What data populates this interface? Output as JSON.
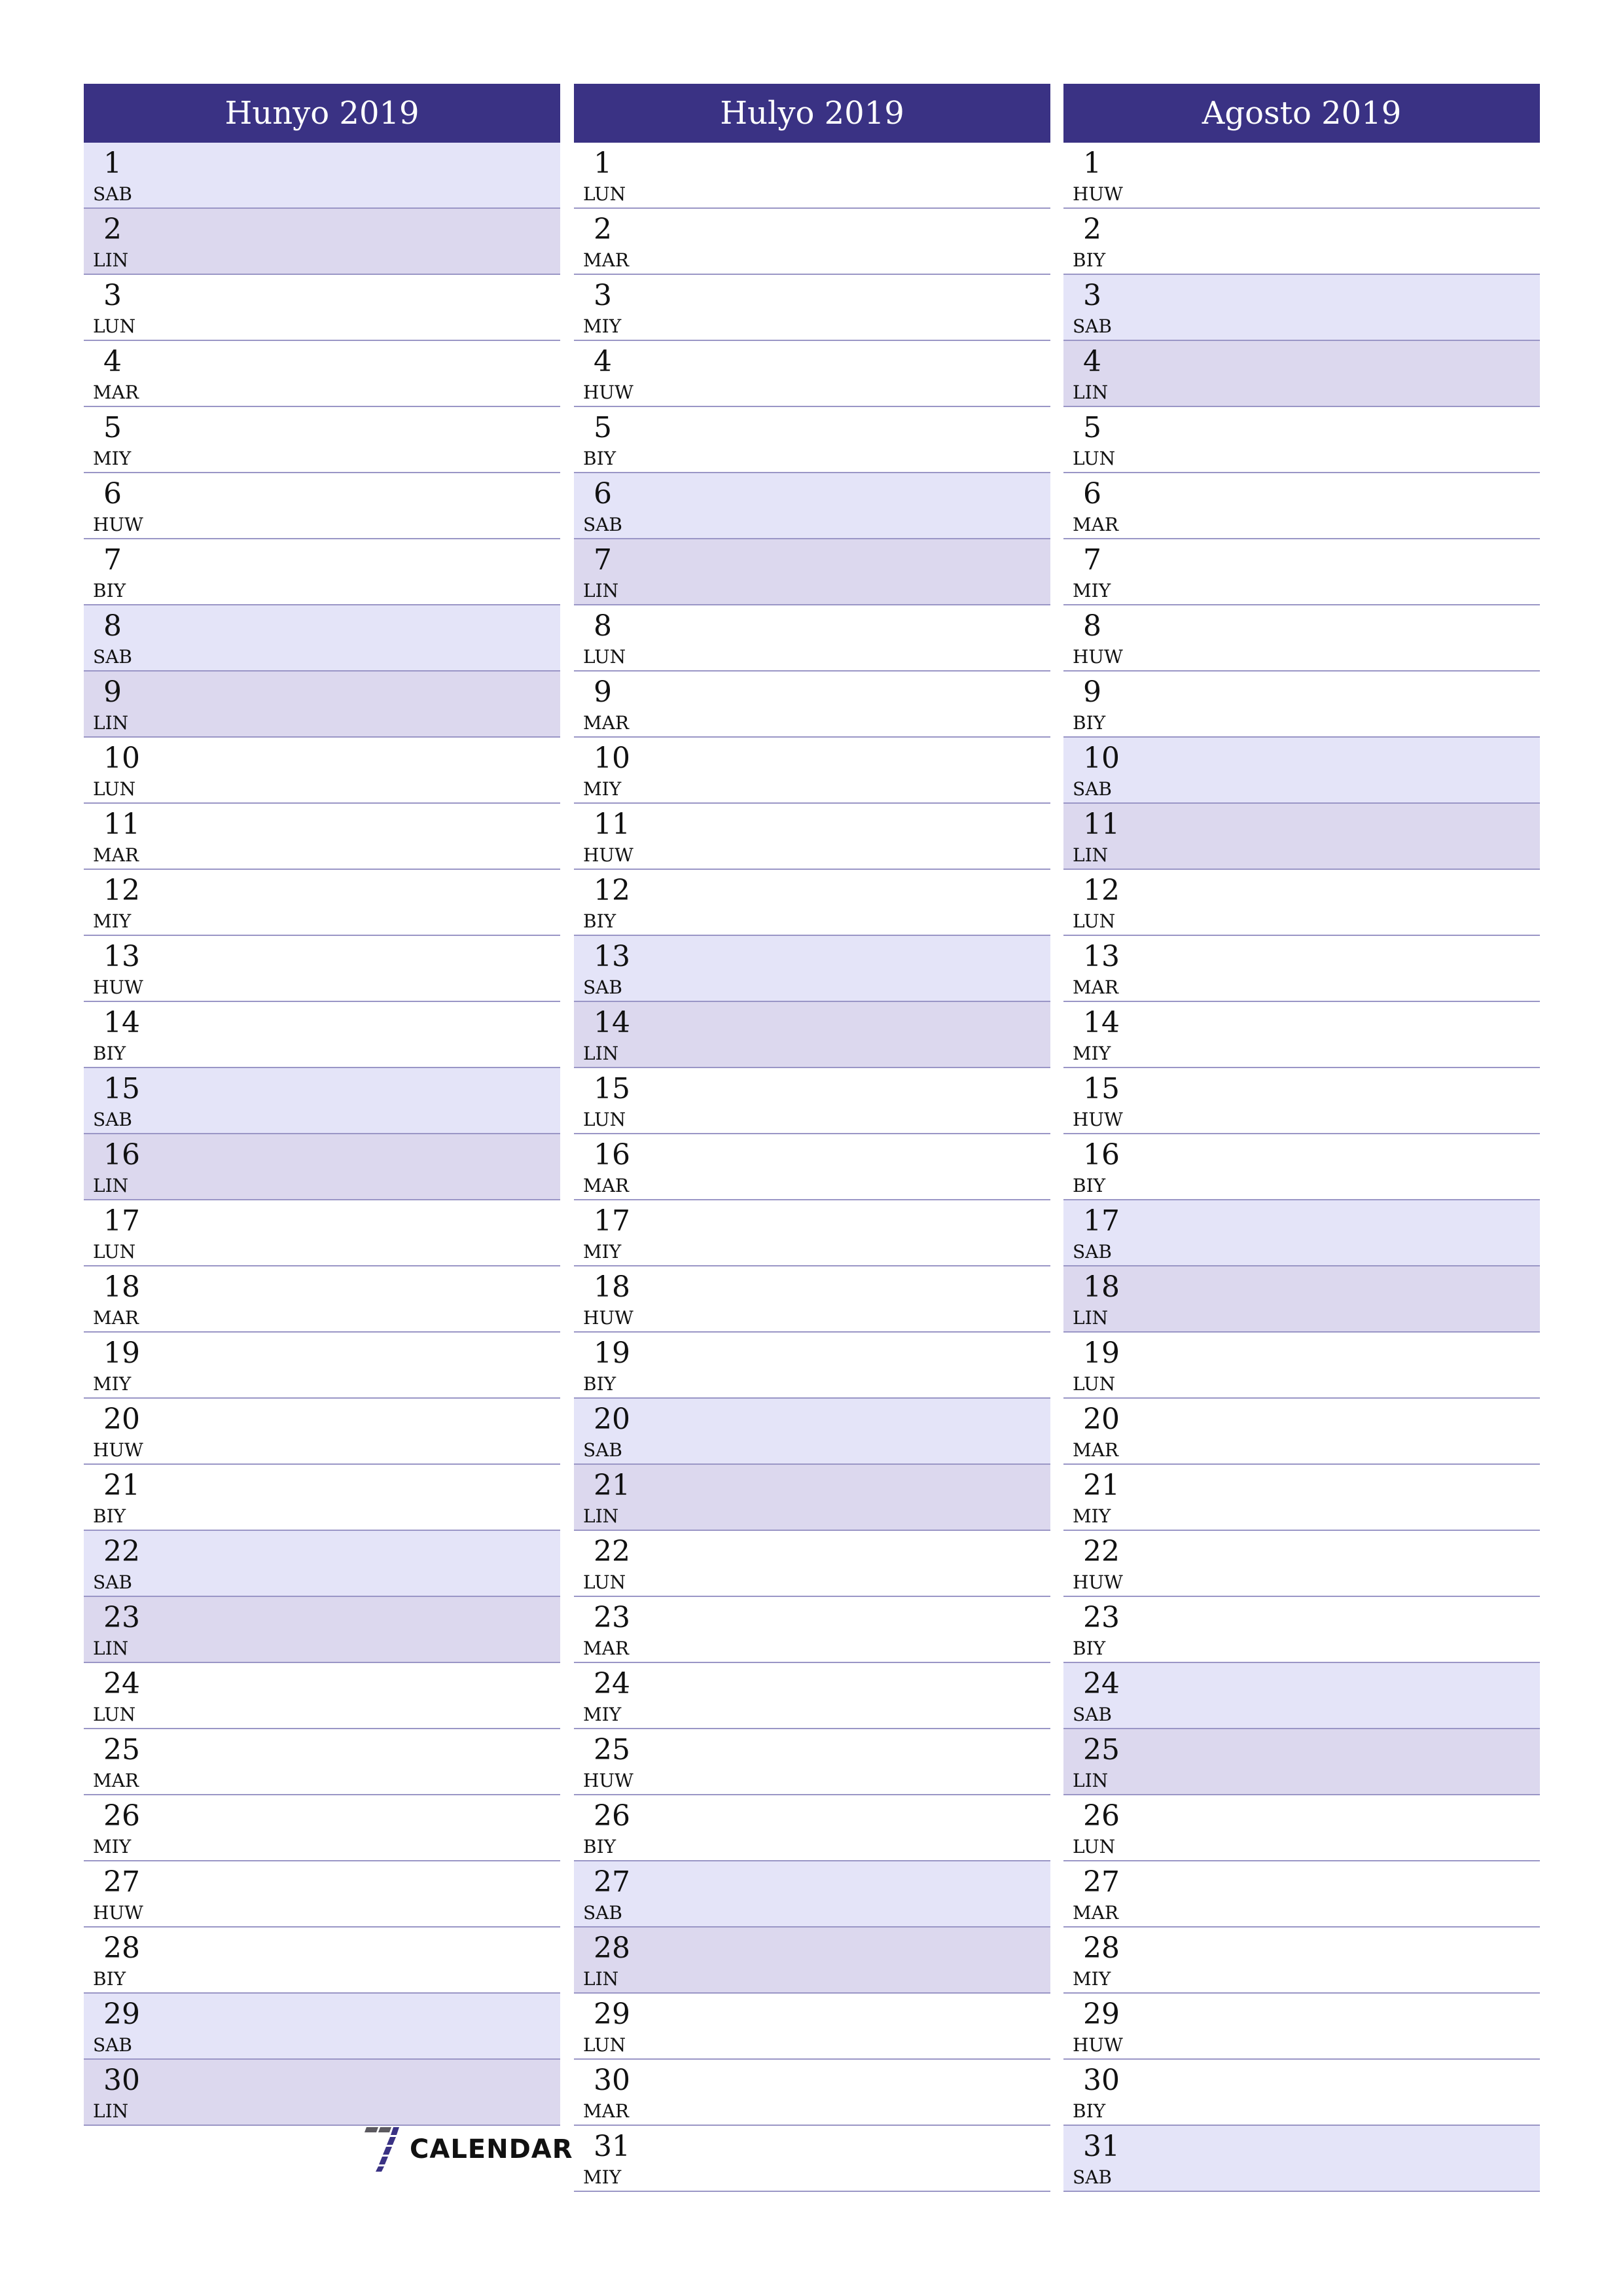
{
  "months": [
    {
      "title": "Hunyo 2019",
      "days": [
        {
          "n": "1",
          "d": "SAB",
          "t": "sat"
        },
        {
          "n": "2",
          "d": "LIN",
          "t": "sun"
        },
        {
          "n": "3",
          "d": "LUN",
          "t": ""
        },
        {
          "n": "4",
          "d": "MAR",
          "t": ""
        },
        {
          "n": "5",
          "d": "MIY",
          "t": ""
        },
        {
          "n": "6",
          "d": "HUW",
          "t": ""
        },
        {
          "n": "7",
          "d": "BIY",
          "t": ""
        },
        {
          "n": "8",
          "d": "SAB",
          "t": "sat"
        },
        {
          "n": "9",
          "d": "LIN",
          "t": "sun"
        },
        {
          "n": "10",
          "d": "LUN",
          "t": ""
        },
        {
          "n": "11",
          "d": "MAR",
          "t": ""
        },
        {
          "n": "12",
          "d": "MIY",
          "t": ""
        },
        {
          "n": "13",
          "d": "HUW",
          "t": ""
        },
        {
          "n": "14",
          "d": "BIY",
          "t": ""
        },
        {
          "n": "15",
          "d": "SAB",
          "t": "sat"
        },
        {
          "n": "16",
          "d": "LIN",
          "t": "sun"
        },
        {
          "n": "17",
          "d": "LUN",
          "t": ""
        },
        {
          "n": "18",
          "d": "MAR",
          "t": ""
        },
        {
          "n": "19",
          "d": "MIY",
          "t": ""
        },
        {
          "n": "20",
          "d": "HUW",
          "t": ""
        },
        {
          "n": "21",
          "d": "BIY",
          "t": ""
        },
        {
          "n": "22",
          "d": "SAB",
          "t": "sat"
        },
        {
          "n": "23",
          "d": "LIN",
          "t": "sun"
        },
        {
          "n": "24",
          "d": "LUN",
          "t": ""
        },
        {
          "n": "25",
          "d": "MAR",
          "t": ""
        },
        {
          "n": "26",
          "d": "MIY",
          "t": ""
        },
        {
          "n": "27",
          "d": "HUW",
          "t": ""
        },
        {
          "n": "28",
          "d": "BIY",
          "t": ""
        },
        {
          "n": "29",
          "d": "SAB",
          "t": "sat"
        },
        {
          "n": "30",
          "d": "LIN",
          "t": "sun"
        }
      ]
    },
    {
      "title": "Hulyo 2019",
      "days": [
        {
          "n": "1",
          "d": "LUN",
          "t": ""
        },
        {
          "n": "2",
          "d": "MAR",
          "t": ""
        },
        {
          "n": "3",
          "d": "MIY",
          "t": ""
        },
        {
          "n": "4",
          "d": "HUW",
          "t": ""
        },
        {
          "n": "5",
          "d": "BIY",
          "t": ""
        },
        {
          "n": "6",
          "d": "SAB",
          "t": "sat"
        },
        {
          "n": "7",
          "d": "LIN",
          "t": "sun"
        },
        {
          "n": "8",
          "d": "LUN",
          "t": ""
        },
        {
          "n": "9",
          "d": "MAR",
          "t": ""
        },
        {
          "n": "10",
          "d": "MIY",
          "t": ""
        },
        {
          "n": "11",
          "d": "HUW",
          "t": ""
        },
        {
          "n": "12",
          "d": "BIY",
          "t": ""
        },
        {
          "n": "13",
          "d": "SAB",
          "t": "sat"
        },
        {
          "n": "14",
          "d": "LIN",
          "t": "sun"
        },
        {
          "n": "15",
          "d": "LUN",
          "t": ""
        },
        {
          "n": "16",
          "d": "MAR",
          "t": ""
        },
        {
          "n": "17",
          "d": "MIY",
          "t": ""
        },
        {
          "n": "18",
          "d": "HUW",
          "t": ""
        },
        {
          "n": "19",
          "d": "BIY",
          "t": ""
        },
        {
          "n": "20",
          "d": "SAB",
          "t": "sat"
        },
        {
          "n": "21",
          "d": "LIN",
          "t": "sun"
        },
        {
          "n": "22",
          "d": "LUN",
          "t": ""
        },
        {
          "n": "23",
          "d": "MAR",
          "t": ""
        },
        {
          "n": "24",
          "d": "MIY",
          "t": ""
        },
        {
          "n": "25",
          "d": "HUW",
          "t": ""
        },
        {
          "n": "26",
          "d": "BIY",
          "t": ""
        },
        {
          "n": "27",
          "d": "SAB",
          "t": "sat"
        },
        {
          "n": "28",
          "d": "LIN",
          "t": "sun"
        },
        {
          "n": "29",
          "d": "LUN",
          "t": ""
        },
        {
          "n": "30",
          "d": "MAR",
          "t": ""
        },
        {
          "n": "31",
          "d": "MIY",
          "t": ""
        }
      ]
    },
    {
      "title": "Agosto 2019",
      "days": [
        {
          "n": "1",
          "d": "HUW",
          "t": ""
        },
        {
          "n": "2",
          "d": "BIY",
          "t": ""
        },
        {
          "n": "3",
          "d": "SAB",
          "t": "sat"
        },
        {
          "n": "4",
          "d": "LIN",
          "t": "sun"
        },
        {
          "n": "5",
          "d": "LUN",
          "t": ""
        },
        {
          "n": "6",
          "d": "MAR",
          "t": ""
        },
        {
          "n": "7",
          "d": "MIY",
          "t": ""
        },
        {
          "n": "8",
          "d": "HUW",
          "t": ""
        },
        {
          "n": "9",
          "d": "BIY",
          "t": ""
        },
        {
          "n": "10",
          "d": "SAB",
          "t": "sat"
        },
        {
          "n": "11",
          "d": "LIN",
          "t": "sun"
        },
        {
          "n": "12",
          "d": "LUN",
          "t": ""
        },
        {
          "n": "13",
          "d": "MAR",
          "t": ""
        },
        {
          "n": "14",
          "d": "MIY",
          "t": ""
        },
        {
          "n": "15",
          "d": "HUW",
          "t": ""
        },
        {
          "n": "16",
          "d": "BIY",
          "t": ""
        },
        {
          "n": "17",
          "d": "SAB",
          "t": "sat"
        },
        {
          "n": "18",
          "d": "LIN",
          "t": "sun"
        },
        {
          "n": "19",
          "d": "LUN",
          "t": ""
        },
        {
          "n": "20",
          "d": "MAR",
          "t": ""
        },
        {
          "n": "21",
          "d": "MIY",
          "t": ""
        },
        {
          "n": "22",
          "d": "HUW",
          "t": ""
        },
        {
          "n": "23",
          "d": "BIY",
          "t": ""
        },
        {
          "n": "24",
          "d": "SAB",
          "t": "sat"
        },
        {
          "n": "25",
          "d": "LIN",
          "t": "sun"
        },
        {
          "n": "26",
          "d": "LUN",
          "t": ""
        },
        {
          "n": "27",
          "d": "MAR",
          "t": ""
        },
        {
          "n": "28",
          "d": "MIY",
          "t": ""
        },
        {
          "n": "29",
          "d": "HUW",
          "t": ""
        },
        {
          "n": "30",
          "d": "BIY",
          "t": ""
        },
        {
          "n": "31",
          "d": "SAB",
          "t": "sat"
        }
      ]
    }
  ],
  "colors": {
    "header": "#3a3284",
    "saturday": "#e4e4f8",
    "sunday": "#dcd8ee",
    "separator": "#9a96c6"
  },
  "logo": {
    "icon": "seven-logo-icon",
    "text": "CALENDAR"
  }
}
